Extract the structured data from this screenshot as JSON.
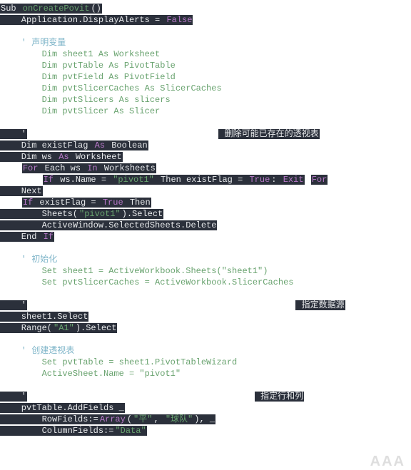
{
  "watermark": "AAA",
  "lines": [
    [
      {
        "t": "Sub",
        "c": "hl white"
      },
      {
        "t": " onCreatePovit",
        "c": "hl green"
      },
      {
        "t": "()",
        "c": "hl white"
      }
    ],
    [
      {
        "t": "    Application.DisplayAlerts = ",
        "c": "hl white"
      },
      {
        "t": "False",
        "c": "hl purple"
      }
    ],
    [
      {
        "t": " ",
        "c": "plain"
      }
    ],
    [
      {
        "t": "    ' 声明变量",
        "c": "cyan"
      }
    ],
    [
      {
        "t": "        Dim sheet1 As Worksheet",
        "c": "green"
      }
    ],
    [
      {
        "t": "        Dim pvtTable As PivotTable",
        "c": "green"
      }
    ],
    [
      {
        "t": "        Dim pvtField As PivotField",
        "c": "green"
      }
    ],
    [
      {
        "t": "        Dim pvtSlicerCaches As SlicerCaches",
        "c": "green"
      }
    ],
    [
      {
        "t": "        Dim pvtSlicers As slicers",
        "c": "green"
      }
    ],
    [
      {
        "t": "        Dim pvtSlicer As Slicer",
        "c": "green"
      }
    ],
    [
      {
        "t": " ",
        "c": "plain"
      }
    ],
    [
      {
        "t": "    '",
        "c": "hl white"
      },
      {
        "t": "                                     ",
        "c": "plain"
      },
      {
        "t": " 删除可能已存在的透视表",
        "c": "hl white"
      }
    ],
    [
      {
        "t": "    Dim existFlag ",
        "c": "hl white"
      },
      {
        "t": "As",
        "c": "hl purple"
      },
      {
        "t": " Boolean",
        "c": "hl white"
      }
    ],
    [
      {
        "t": "    Dim ws ",
        "c": "hl white"
      },
      {
        "t": "As",
        "c": "hl purple"
      },
      {
        "t": " Worksheet",
        "c": "hl white"
      }
    ],
    [
      {
        "t": "    ",
        "c": "plain"
      },
      {
        "t": "For",
        "c": "hl purple"
      },
      {
        "t": " Each ws ",
        "c": "hl white"
      },
      {
        "t": "In",
        "c": "hl purple"
      },
      {
        "t": " Worksheets",
        "c": "hl white"
      }
    ],
    [
      {
        "t": "        ",
        "c": "plain"
      },
      {
        "t": "If",
        "c": "hl purple"
      },
      {
        "t": " ws.Name = ",
        "c": "hl white"
      },
      {
        "t": "\"pivot1\"",
        "c": "hl green"
      },
      {
        "t": " Then existFlag = ",
        "c": "hl white"
      },
      {
        "t": "True",
        "c": "hl purple"
      },
      {
        "t": ": ",
        "c": "hl white"
      },
      {
        "t": "Exit",
        "c": "hl purple"
      },
      {
        "t": " ",
        "c": "plain"
      },
      {
        "t": "For",
        "c": "hl purple"
      }
    ],
    [
      {
        "t": "    Next",
        "c": "hl white"
      }
    ],
    [
      {
        "t": "    ",
        "c": "plain"
      },
      {
        "t": "If",
        "c": "hl purple"
      },
      {
        "t": " existFlag = ",
        "c": "hl white"
      },
      {
        "t": "True",
        "c": "hl purple"
      },
      {
        "t": " Then",
        "c": "hl white"
      }
    ],
    [
      {
        "t": "        Sheets(",
        "c": "hl white"
      },
      {
        "t": "\"pivot1\"",
        "c": "hl green"
      },
      {
        "t": ").Select",
        "c": "hl white"
      }
    ],
    [
      {
        "t": "        ActiveWindow.SelectedSheets.Delete",
        "c": "hl white"
      }
    ],
    [
      {
        "t": "    End ",
        "c": "hl white"
      },
      {
        "t": "If",
        "c": "hl purple"
      }
    ],
    [
      {
        "t": " ",
        "c": "plain"
      }
    ],
    [
      {
        "t": "    ' 初始化",
        "c": "cyan"
      }
    ],
    [
      {
        "t": "        Set sheet1 = ActiveWorkbook.Sheets(\"sheet1\")",
        "c": "green"
      }
    ],
    [
      {
        "t": "        Set pvtSlicerCaches = ActiveWorkbook.SlicerCaches",
        "c": "green"
      }
    ],
    [
      {
        "t": " ",
        "c": "plain"
      }
    ],
    [
      {
        "t": "    '",
        "c": "hl white"
      },
      {
        "t": "                                                    ",
        "c": "plain"
      },
      {
        "t": " 指定数据源",
        "c": "hl white"
      }
    ],
    [
      {
        "t": "    sheet1.Select",
        "c": "hl white"
      }
    ],
    [
      {
        "t": "    Range(",
        "c": "hl white"
      },
      {
        "t": "\"A1\"",
        "c": "hl green"
      },
      {
        "t": ").Select",
        "c": "hl white"
      }
    ],
    [
      {
        "t": " ",
        "c": "plain"
      }
    ],
    [
      {
        "t": "    ' 创建透视表",
        "c": "cyan"
      }
    ],
    [
      {
        "t": "        Set pvtTable = sheet1.PivotTableWizard",
        "c": "green"
      }
    ],
    [
      {
        "t": "        ActiveSheet.Name = \"pivot1\"",
        "c": "green"
      }
    ],
    [
      {
        "t": " ",
        "c": "plain"
      }
    ],
    [
      {
        "t": "    '",
        "c": "hl white"
      },
      {
        "t": "                                            ",
        "c": "plain"
      },
      {
        "t": " 指定行和列",
        "c": "hl white"
      }
    ],
    [
      {
        "t": "    pvtTable.AddFields _",
        "c": "hl white"
      }
    ],
    [
      {
        "t": "        RowFields:=",
        "c": "hl white"
      },
      {
        "t": "Array",
        "c": "hl purple"
      },
      {
        "t": "(",
        "c": "hl white"
      },
      {
        "t": "\"平\"",
        "c": "hl green"
      },
      {
        "t": ", ",
        "c": "hl white"
      },
      {
        "t": "\"球队\"",
        "c": "hl green"
      },
      {
        "t": "), _",
        "c": "hl white"
      }
    ],
    [
      {
        "t": "        ColumnFields:=",
        "c": "hl white"
      },
      {
        "t": "\"Data\"",
        "c": "hl green"
      }
    ]
  ]
}
